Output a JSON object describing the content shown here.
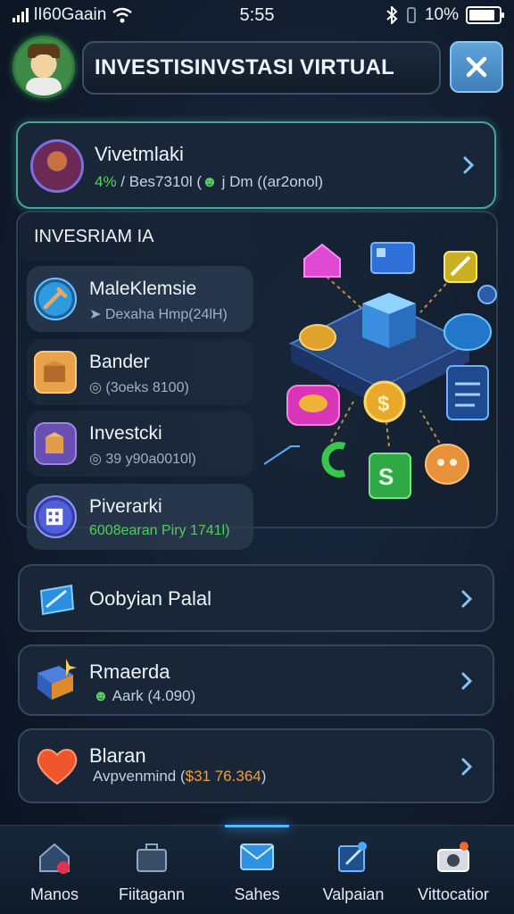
{
  "status_bar": {
    "carrier": "lI60Gaain",
    "time": "5:55",
    "battery": "10%"
  },
  "header": {
    "title": "INVESTISINVSTASI VIRTUAL"
  },
  "top_card": {
    "name": "Vivetmlaki",
    "percent": "4%",
    "detail": " / Bes7310l (",
    "green_mark": "☻",
    "detail_end": " j Dm ((ar2onol)"
  },
  "section": {
    "title": "INVESRIAM IA"
  },
  "list_items": [
    {
      "title": "MaleKlemsie",
      "subtitle": "➤ Dexaha Hmp(24lH)",
      "green": false
    },
    {
      "title": "Bander",
      "subtitle": "◎ (3oeks 8100)",
      "green": false
    },
    {
      "title": "Investcki",
      "subtitle": "◎ 39 y90a0010l)",
      "green": false
    },
    {
      "title": "Piverarki",
      "subtitle": "6008earan Piry 1741l)",
      "green": true
    }
  ],
  "rows": [
    {
      "title": "Oobyian Palal",
      "subtitle": ""
    },
    {
      "title": "Rmaerda",
      "subtitle_green": "☻",
      "subtitle": " Aark (4.090)"
    },
    {
      "title": "Blaran",
      "subtitle": "Avpvenmind (",
      "subtitle_green": "$31 76.364",
      "subtitle_end": ")"
    }
  ],
  "bottom_nav": [
    {
      "label": "Manos",
      "icon": "home-icon"
    },
    {
      "label": "Fiitagann",
      "icon": "briefcase-icon"
    },
    {
      "label": "Sahes",
      "icon": "mail-icon"
    },
    {
      "label": "Valpaian",
      "icon": "edit-icon"
    },
    {
      "label": "Vittocatior",
      "icon": "camera-icon"
    }
  ],
  "colors": {
    "accent": "#4db7ff",
    "positive": "#59d15b",
    "background": "#111c2d"
  }
}
